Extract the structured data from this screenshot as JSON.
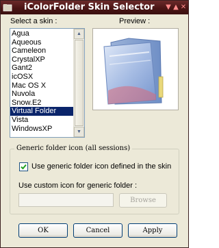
{
  "window": {
    "title": "iColorFolder Skin Selector"
  },
  "skins": {
    "label": "Select a skin :",
    "items": [
      "Agua",
      "Aqueous",
      "Cameleon",
      "CrystalXP",
      "Gant2",
      "icOSX",
      "Mac OS X",
      "Nuvola",
      "Snow.E2",
      "Virtual Folder",
      "Vista",
      "WindowsXP"
    ],
    "selected": "Virtual Folder"
  },
  "preview": {
    "label": "Preview :"
  },
  "generic": {
    "group_label": "Generic folder icon (all sessions)",
    "checkbox_label": "Use generic folder icon defined in the skin",
    "checkbox_checked": true,
    "custom_label": "Use custom icon for generic folder :",
    "custom_value": "",
    "browse_label": "Browse"
  },
  "buttons": {
    "ok": "OK",
    "cancel": "Cancel",
    "apply": "Apply"
  },
  "colors": {
    "title_bar": "#4a1515",
    "selection": "#0a246a"
  }
}
